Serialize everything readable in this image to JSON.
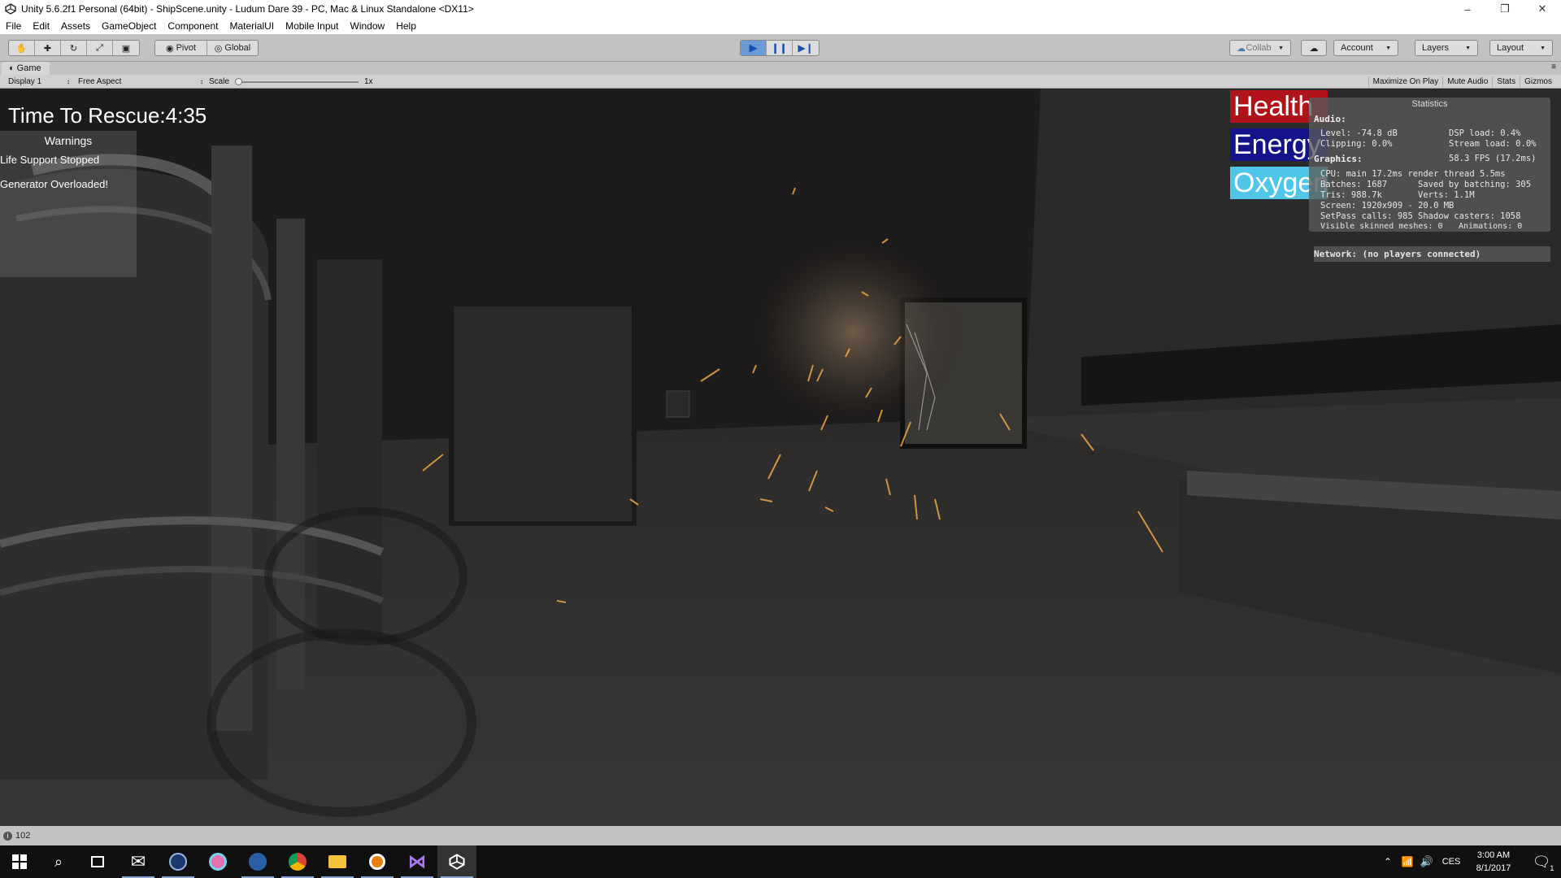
{
  "window": {
    "title": "Unity 5.6.2f1 Personal (64bit) - ShipScene.unity - Ludum Dare 39 - PC, Mac & Linux Standalone <DX11>"
  },
  "menu": [
    "File",
    "Edit",
    "Assets",
    "GameObject",
    "Component",
    "MaterialUI",
    "Mobile Input",
    "Window",
    "Help"
  ],
  "toolbar": {
    "pivot_label": "Pivot",
    "global_label": "Global",
    "collab_label": "Collab",
    "account_label": "Account",
    "layers_label": "Layers",
    "layout_label": "Layout"
  },
  "game": {
    "tab_label": "Game",
    "display_label": "Display 1",
    "aspect_label": "Free Aspect",
    "scale_label": "Scale",
    "scale_value": "1x",
    "maximize_label": "Maximize On Play",
    "mute_label": "Mute Audio",
    "stats_label": "Stats",
    "gizmos_label": "Gizmos"
  },
  "hud": {
    "timer_label": "Time To Rescue:",
    "timer_value": "4:35",
    "warnings_title": "Warnings",
    "warnings": [
      "Life Support Stopped",
      "Generator Overloaded!"
    ],
    "bars": [
      {
        "label": "Health",
        "color": "#b0141a"
      },
      {
        "label": "Energy",
        "color": "#13138a"
      },
      {
        "label": "Oxygen",
        "color": "#4fc6e8"
      }
    ]
  },
  "stats": {
    "header": "Statistics",
    "audio_label": "Audio:",
    "level": "Level: -74.8 dB",
    "dsp": "DSP load: 0.4%",
    "clipping": "Clipping: 0.0%",
    "stream": "Stream load: 0.0%",
    "graphics_label": "Graphics:",
    "fps": "58.3 FPS (17.2ms)",
    "cpu": "CPU: main 17.2ms  render thread 5.5ms",
    "batches": "Batches: 1687",
    "saved": "Saved by batching: 305",
    "tris": "Tris: 988.7k",
    "verts": "Verts: 1.1M",
    "screen": "Screen: 1920x909 - 20.0 MB",
    "setpass": "SetPass calls: 985",
    "shadow": "Shadow casters: 1058",
    "skinned": "Visible skinned meshes: 0",
    "animations": "Animations: 0",
    "network": "Network: (no players connected)"
  },
  "status": {
    "count": "102"
  },
  "taskbar": {
    "lang": "CES",
    "time": "3:00 AM",
    "date": "8/1/2017",
    "notification_count": "1",
    "accent": "#8aa8d8"
  }
}
